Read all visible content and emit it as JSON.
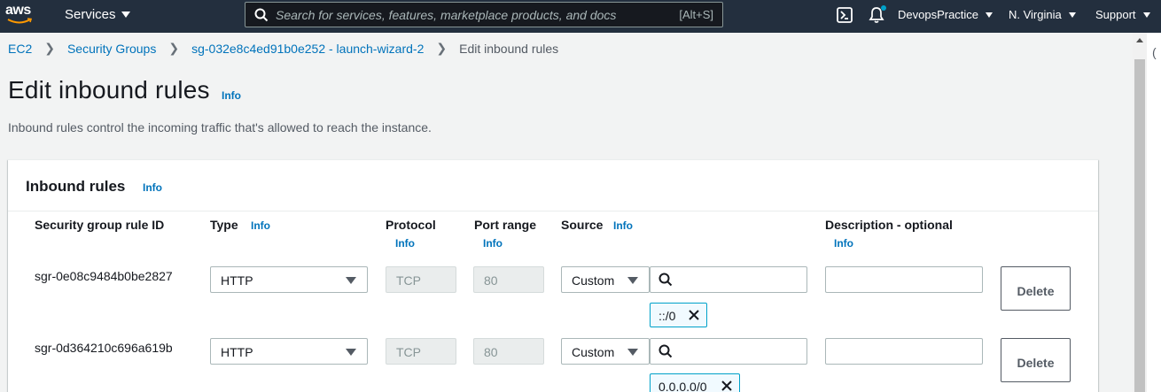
{
  "nav": {
    "logo_text": "aws",
    "services_label": "Services",
    "search_placeholder": "Search for services, features, marketplace products, and docs",
    "search_shortcut": "[Alt+S]",
    "account_label": "DevopsPractice",
    "region_label": "N. Virginia",
    "support_label": "Support"
  },
  "breadcrumb": {
    "items": [
      "EC2",
      "Security Groups",
      "sg-032e8c4ed91b0e252 - launch-wizard-2"
    ],
    "current": "Edit inbound rules"
  },
  "page": {
    "title": "Edit inbound rules",
    "info": "Info",
    "description": "Inbound rules control the incoming traffic that's allowed to reach the instance."
  },
  "panel": {
    "title": "Inbound rules",
    "info": "Info",
    "columns": {
      "rule_id": "Security group rule ID",
      "type": "Type",
      "protocol": "Protocol",
      "port_range": "Port range",
      "source": "Source",
      "description": "Description - optional",
      "info": "Info"
    },
    "rows": [
      {
        "rule_id": "sgr-0e08c9484b0be2827",
        "type": "HTTP",
        "protocol": "TCP",
        "port": "80",
        "source_type": "Custom",
        "source_search": "",
        "cidr": "::/0",
        "description": "",
        "delete_label": "Delete"
      },
      {
        "rule_id": "sgr-0d364210c696a619b",
        "type": "HTTP",
        "protocol": "TCP",
        "port": "80",
        "source_type": "Custom",
        "source_search": "",
        "cidr": "0.0.0.0/0",
        "description": "",
        "delete_label": "Delete"
      }
    ]
  },
  "colors": {
    "nav_bg": "#232f3e",
    "link": "#0073bb",
    "token_border": "#00a1c9",
    "page_bg": "#f2f3f3"
  },
  "icons": [
    "search-icon",
    "cloudshell-icon",
    "notifications-bell-icon",
    "dropdown-caret-icon",
    "magnifier-icon",
    "remove-x-icon"
  ]
}
